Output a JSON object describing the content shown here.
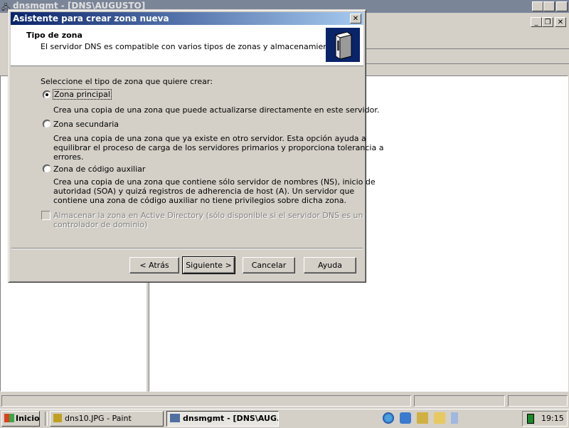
{
  "background_window": {
    "title": "dnsmgmt - [DNS\\AUGUSTO]"
  },
  "dialog": {
    "title": "Asistente para crear zona nueva",
    "header_title": "Tipo de zona",
    "header_subtitle": "El servidor DNS es compatible con varios tipos de zonas y almacenamientos.",
    "prompt": "Seleccione el tipo de zona que quiere crear:",
    "options": [
      {
        "label": "Zona principal",
        "selected": true,
        "description": [
          "Crea una copia de una zona que puede actualizarse directamente en este servidor."
        ]
      },
      {
        "label": "Zona secundaria",
        "selected": false,
        "description": [
          "Crea una copia de una zona que ya existe en otro servidor. Esta opción ayuda a",
          "equilibrar el proceso de carga de los servidores primarios y proporciona tolerancia a",
          "errores."
        ]
      },
      {
        "label": "Zona de código auxiliar",
        "selected": false,
        "description": [
          "Crea una copia de una zona que contiene sólo servidor de nombres (NS), inicio de",
          "autoridad (SOA) y quizá registros de adherencia de host (A). Un servidor que",
          "contiene una zona de código auxiliar no tiene privilegios sobre dicha zona."
        ]
      }
    ],
    "ad_checkbox": {
      "lines": [
        "Almacenar la zona en Active Directory (sólo disponible si el servidor DNS es un",
        "controlador de dominio)"
      ],
      "checked": false,
      "enabled": false
    },
    "buttons": {
      "back": "< Atrás",
      "next": "Siguiente >",
      "cancel": "Cancelar",
      "help": "Ayuda"
    }
  },
  "taskbar": {
    "start_label": "Inicio",
    "tasks": [
      {
        "label": "dns10.JPG - Paint",
        "active": false
      },
      {
        "label": "dnsmgmt - [DNS\\AUG...",
        "active": true
      }
    ],
    "clock": "19:15",
    "quick_launch_icons": [
      "ie-icon",
      "app-icon",
      "recycle-icon",
      "folder-icon",
      "notepad-icon"
    ]
  },
  "colors": {
    "title_active_start": "#0a246a",
    "title_active_end": "#a6caf0",
    "face": "#d4d0c8"
  }
}
